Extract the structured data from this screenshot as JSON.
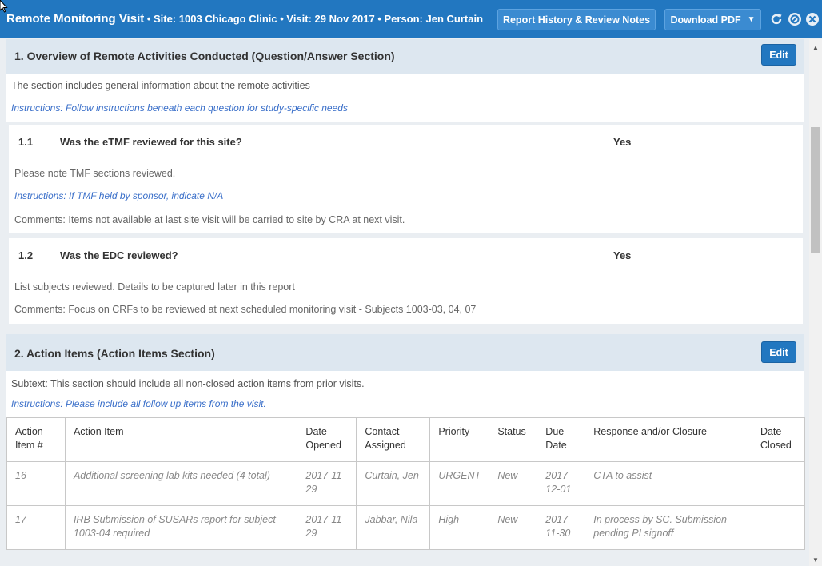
{
  "header": {
    "title": "Remote Monitoring Visit",
    "subtitle": " • Site: 1003 Chicago Clinic • Visit: 29 Nov 2017 • Person: Jen Curtain",
    "history_button": "Report History & Review Notes",
    "pdf_button": "Download PDF",
    "icons": [
      "refresh-icon",
      "block-icon",
      "close-icon"
    ]
  },
  "section1": {
    "title": "1. Overview of Remote Activities Conducted (Question/Answer Section)",
    "edit_label": "Edit",
    "description": "The section includes general information about the remote activities",
    "instructions": "Instructions: Follow instructions beneath each question for study-specific needs",
    "questions": [
      {
        "number": "1.1",
        "text": "Was the eTMF reviewed for this site?",
        "answer": "Yes",
        "note": "Please note TMF sections reviewed.",
        "instructions": "Instructions: If TMF held by sponsor, indicate N/A",
        "comments": "Comments: Items not available at last site visit will be carried to site by CRA at next visit."
      },
      {
        "number": "1.2",
        "text": "Was the EDC reviewed?",
        "answer": "Yes",
        "note": "List subjects reviewed. Details to be captured later in this report",
        "comments": "Comments: Focus on CRFs to be reviewed at next scheduled monitoring visit - Subjects 1003-03, 04, 07"
      }
    ]
  },
  "section2": {
    "title": "2. Action Items (Action Items Section)",
    "edit_label": "Edit",
    "subtext": "Subtext: This section should include all non-closed action items from prior visits.",
    "instructions": "Instructions: Please include all follow up items from the visit.",
    "columns": [
      "Action Item #",
      "Action Item",
      "Date Opened",
      "Contact Assigned",
      "Priority",
      "Status",
      "Due Date",
      "Response and/or Closure",
      "Date Closed"
    ],
    "rows": [
      [
        "16",
        "Additional screening lab kits needed (4 total)",
        "2017-11-29",
        "Curtain, Jen",
        "URGENT",
        "New",
        "2017-12-01",
        "CTA to assist",
        ""
      ],
      [
        "17",
        "IRB Submission of SUSARs report for subject 1003-04 required",
        "2017-11-29",
        "Jabbar, Nila",
        "High",
        "New",
        "2017-11-30",
        "In process by SC. Submission pending PI signoff",
        ""
      ]
    ]
  },
  "colors": {
    "header_bg": "#2277c0",
    "section_bg": "#dde7f0",
    "instructions_text": "#3a6fc9"
  }
}
